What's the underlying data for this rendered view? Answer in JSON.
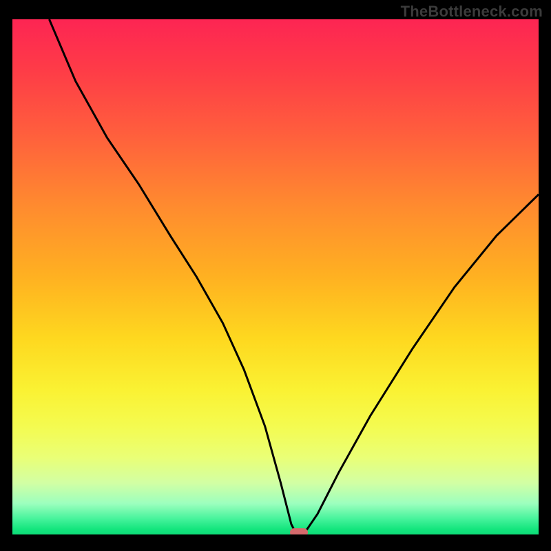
{
  "watermark": "TheBottleneck.com",
  "colors": {
    "black_frame": "#000000",
    "curve_stroke": "#000000",
    "marker_fill": "#d46a6c",
    "gradient_stops": [
      "#fd2553",
      "#fe3c47",
      "#ff5e3d",
      "#ff8a2f",
      "#ffb121",
      "#fed81f",
      "#faf233",
      "#f4fb50",
      "#eaff76",
      "#d2ffa4",
      "#9cffbe",
      "#45f39b",
      "#13e57d",
      "#0edc78"
    ]
  },
  "chart_data": {
    "type": "line",
    "title": "",
    "xlabel": "",
    "ylabel": "",
    "xlim": [
      0,
      100
    ],
    "ylim": [
      0,
      100
    ],
    "note": "V-shaped bottleneck curve on rainbow gradient background; minimum at x≈54 touching y=0.",
    "series": [
      {
        "name": "bottleneck-curve",
        "x": [
          7,
          12,
          18,
          24,
          30,
          35,
          40,
          44,
          48,
          51,
          53,
          54,
          55,
          56,
          58,
          62,
          68,
          76,
          84,
          92,
          100
        ],
        "y": [
          100,
          88,
          77,
          68,
          58,
          50,
          41,
          32,
          21,
          10,
          2,
          0,
          0,
          1,
          4,
          12,
          23,
          36,
          48,
          58,
          66
        ]
      }
    ],
    "marker": {
      "x": 54.5,
      "y": 0.4
    }
  }
}
